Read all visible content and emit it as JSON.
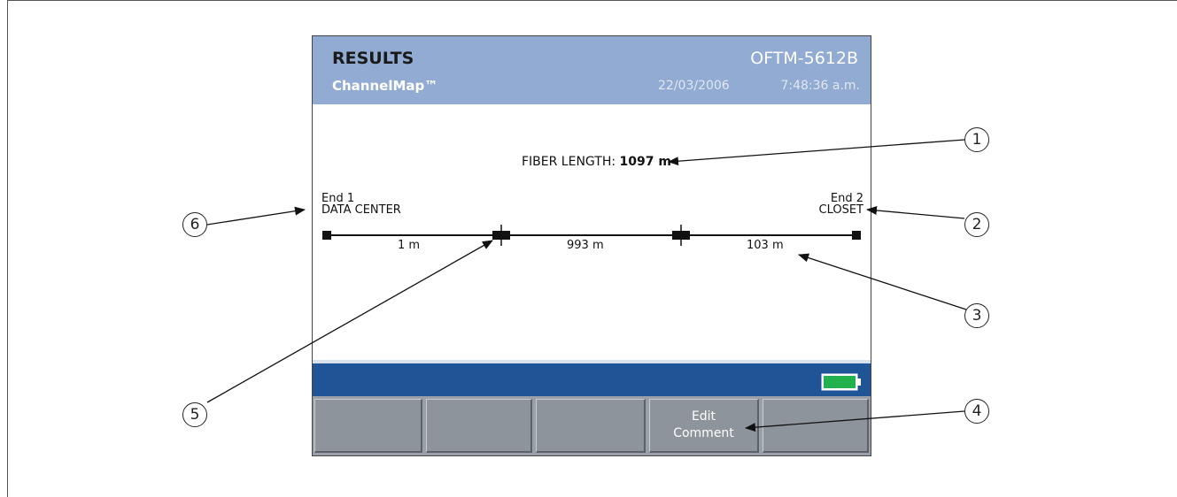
{
  "header": {
    "title": "RESULTS",
    "model": "OFTM-5612B",
    "subtitle": "ChannelMap™",
    "date": "22/03/2006",
    "time": "7:48:36 a.m."
  },
  "channel_map": {
    "fiber_length_label": "FIBER LENGTH:",
    "fiber_length_value": "1097 m",
    "end1": {
      "name": "End 1",
      "location": "DATA CENTER"
    },
    "end2": {
      "name": "End 2",
      "location": "CLOSET"
    },
    "segments": [
      "1 m",
      "993 m",
      "103 m"
    ]
  },
  "status": {
    "battery": "full",
    "battery_color": "#22b14c"
  },
  "softkeys": [
    "",
    "",
    "",
    "Edit Comment",
    ""
  ],
  "softkey_lines": {
    "key4_line1": "Edit",
    "key4_line2": "Comment"
  },
  "callouts": [
    "1",
    "2",
    "3",
    "4",
    "5",
    "6"
  ],
  "colors": {
    "header": "#92abd2",
    "statusbar": "#1f5496",
    "softkey": "#8e949c"
  }
}
